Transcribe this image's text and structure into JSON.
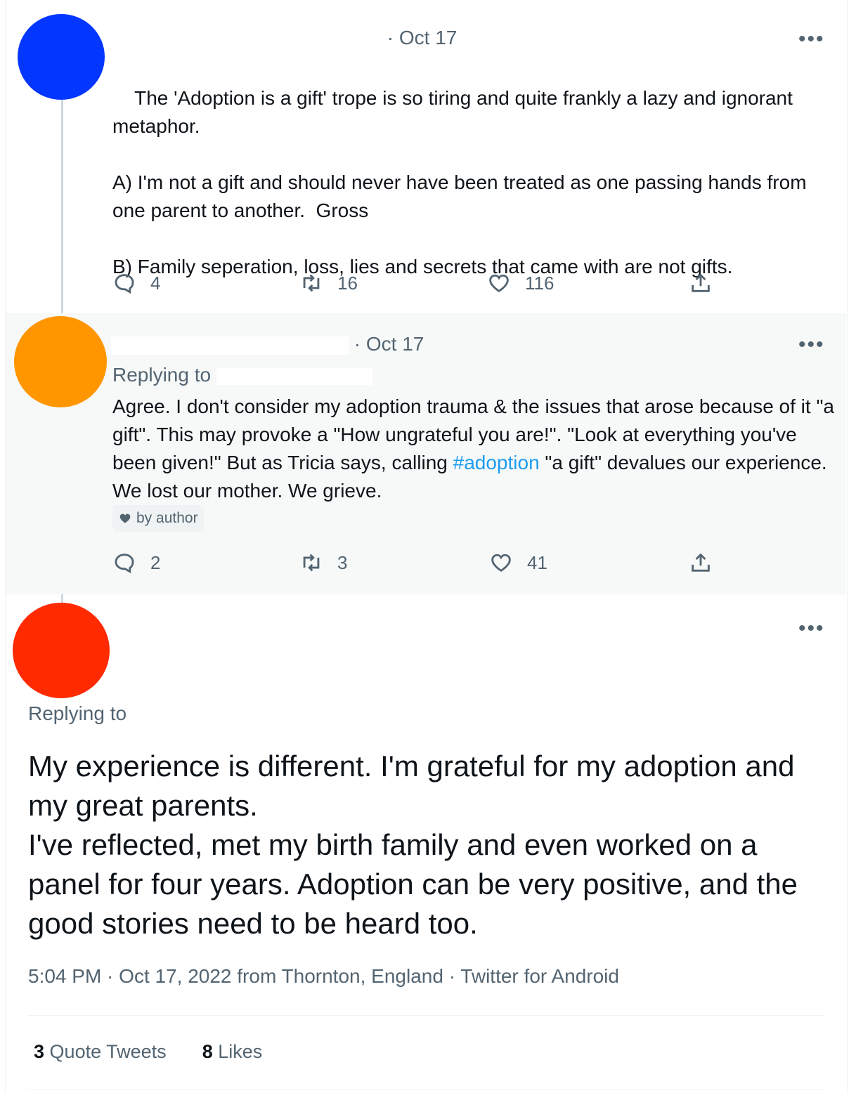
{
  "tweets": [
    {
      "avatar_color": "#0336ff",
      "date": "· Oct 17",
      "more": "•••",
      "body_parts": [
        {
          "text": "The 'Adoption is a gift' trope is so tiring and quite frankly a lazy and ignorant metaphor.\n\nA) I'm not a gift and should never have been treated as one passing hands from one parent to another.  Gross\n\nB) Family seperation, loss, lies and secrets that came with are not gifts."
        }
      ],
      "replies": "4",
      "retweets": "16",
      "likes": "116"
    },
    {
      "avatar_color": "#ff9600",
      "date": "· Oct 17",
      "more": "•••",
      "replying_label": "Replying to",
      "body_parts": [
        {
          "text": "Agree. I don't consider my adoption trauma & the issues that arose because of it \"a gift\". This may provoke a \"How ungrateful you are!\". \"Look at everything you've been given!\" But as Tricia says, calling "
        },
        {
          "text": "#adoption",
          "link": true
        },
        {
          "text": " \"a gift\" devalues our experience. We lost our mother. We grieve."
        }
      ],
      "badge": "by author",
      "replies": "2",
      "retweets": "3",
      "likes": "41"
    }
  ],
  "main_tweet": {
    "avatar_color": "#ff2a00",
    "more": "•••",
    "replying_label": "Replying to",
    "text": "My experience is different. I'm grateful for my adoption and my great parents.\nI've reflected, met my birth family and even worked on a panel for four years. Adoption can be very positive, and the good stories need to be heard too.",
    "meta": "5:04 PM · Oct 17, 2022 from Thornton, England · Twitter for Android",
    "quote_count": "3",
    "quote_label": "Quote Tweets",
    "likes_count": "8",
    "likes_label": "Likes"
  },
  "icons": {
    "reply": "reply-icon",
    "retweet": "retweet-icon",
    "like": "heart-icon",
    "share": "share-icon"
  }
}
